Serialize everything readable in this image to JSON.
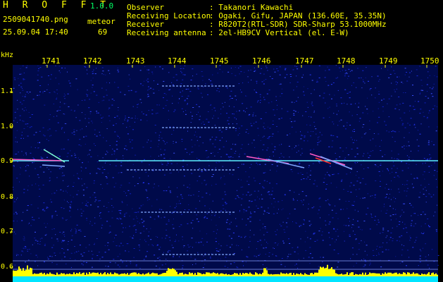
{
  "header": {
    "app_name": "H R O F F T",
    "version": "1.0.0",
    "filename": "2509041740.png",
    "datetime": "25.09.04 17:40",
    "meteor_label": "meteor",
    "meteor_count": "69",
    "info": [
      {
        "label": "Observer",
        "value": ": Takanori Kawachi"
      },
      {
        "label": "Receiving Location",
        "value": ": Ogaki, Gifu, JAPAN (136.60E, 35.35N)"
      },
      {
        "label": "Receiver",
        "value": ": R820T2(RTL-SDR) SDR-Sharp 53.1000MHz"
      },
      {
        "label": "Receiving antenna",
        "value": ": 2el-HB9CV Vertical (el. E-W)"
      }
    ]
  },
  "spectrogram": {
    "y_unit": "kHz",
    "time_ticks": [
      "1741",
      "1742",
      "1743",
      "1744",
      "1745",
      "1746",
      "1747",
      "1748",
      "1749",
      "1750"
    ],
    "freq_ticks": [
      "1.1",
      "1.0",
      "0.9",
      "0.8",
      "0.7",
      "0.6"
    ],
    "colors": {
      "background": "#000a4a",
      "carrier": "#5ef0ff",
      "meteor": "#ff5ac8",
      "level": "#ffff00",
      "level_base": "#00e5ff",
      "tick": "#ffff00"
    }
  }
}
